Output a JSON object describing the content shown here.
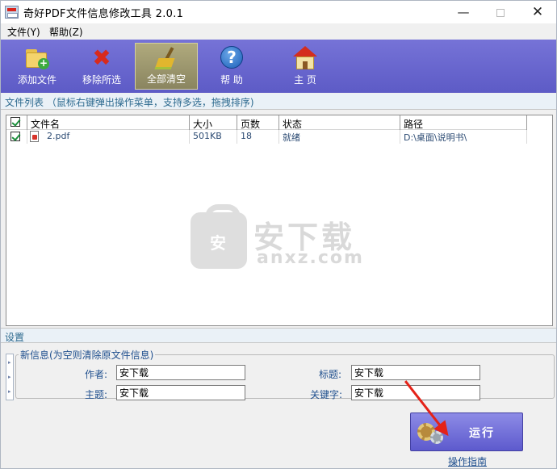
{
  "window": {
    "title": "奇好PDF文件信息修改工具 2.0.1",
    "min_glyph": "—",
    "close_glyph": "✕"
  },
  "menu": {
    "file": "文件(Y)",
    "help": "帮助(Z)"
  },
  "toolbar": {
    "add_file": "添加文件",
    "remove_selected": "移除所选",
    "clear_all": "全部清空",
    "help": "帮 助",
    "home": "主 页",
    "help_glyph": "?",
    "remove_glyph": "✖",
    "plus_glyph": "+"
  },
  "file_list": {
    "header": "文件列表 （鼠标右键弹出操作菜单，支持多选，拖拽排序)",
    "columns": [
      "文件名",
      "大小",
      "页数",
      "状态",
      "路径"
    ],
    "rows": [
      {
        "name": "2.pdf",
        "size": "501KB",
        "pages": "18",
        "status": "就绪",
        "path": "D:\\桌面\\说明书\\"
      }
    ]
  },
  "watermark": {
    "text": "安下载",
    "sub": "anxz.com",
    "bag_char": "安"
  },
  "settings": {
    "header": "设置",
    "group_title": "新信息(为空则清除原文件信息)",
    "author_label": "作者:",
    "author_value": "安下载",
    "subject_label": "主题:",
    "subject_value": "安下载",
    "title_label": "标题:",
    "title_value": "安下载",
    "keywords_label": "关键字:",
    "keywords_value": "安下载",
    "side_glyph": "▸"
  },
  "actions": {
    "run": "运行",
    "guide": "操作指南"
  },
  "colors": {
    "toolbar": "#6866cf",
    "run_button": "#7472dc",
    "annotation_arrow": "#e42218"
  }
}
